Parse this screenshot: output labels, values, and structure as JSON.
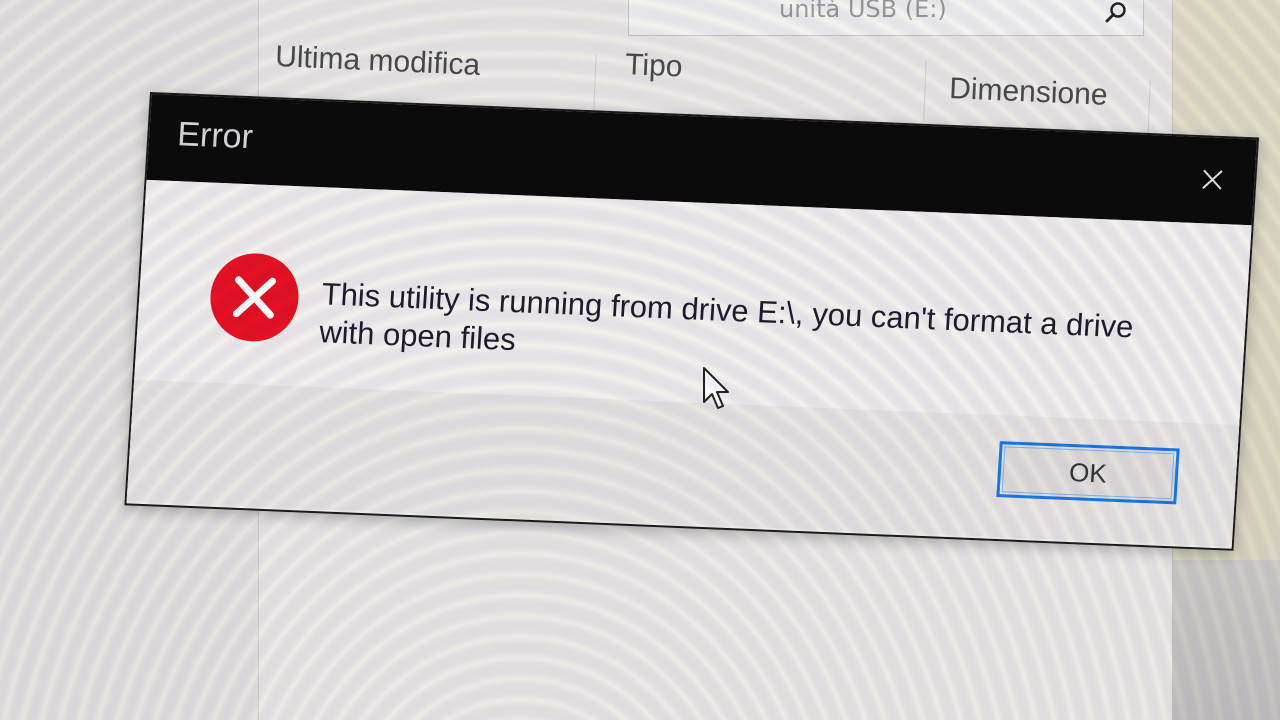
{
  "explorer": {
    "search_text": "unità USB (E:)",
    "search_icon": "search-icon",
    "columns": [
      {
        "label": "Ultima modifica"
      },
      {
        "label": "Tipo"
      },
      {
        "label": "Dimensione"
      }
    ]
  },
  "dialog": {
    "title": "Error",
    "close_icon": "close-icon",
    "error_icon": "error-icon",
    "message": "This utility is running from drive E:\\, you can't format a drive with open files",
    "ok_label": "OK"
  },
  "colors": {
    "titlebar": "#0b0b0b",
    "error_red": "#e81123",
    "button_focus_border": "#1979e6"
  }
}
